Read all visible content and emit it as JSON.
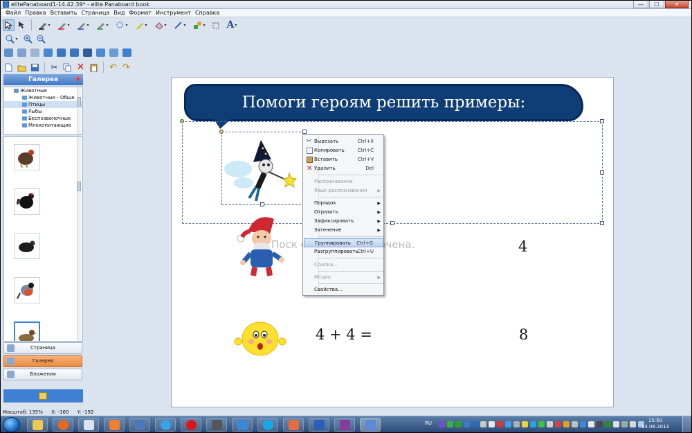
{
  "window": {
    "title": "elitePanaboard1-14.42.39* - elite Panaboard book",
    "minimize": "—",
    "maximize": "☐",
    "close": "✕"
  },
  "menu": [
    "Файл",
    "Правка",
    "Вставить",
    "Страница",
    "Вид",
    "Формат",
    "Инструмент",
    "Справка"
  ],
  "toolbar_icons": {
    "row1": [
      "select-arrow-icon",
      "pointer-tools-icon",
      "pen-icon",
      "red-pen-icon",
      "blue-pen-icon",
      "green-pen-icon",
      "brush-icon",
      "highlighter-icon",
      "eraser-icon",
      "line-icon",
      "shapes-icon",
      "resize-handle-icon",
      "text-icon"
    ],
    "row2": [
      "magnifier-icon",
      "zoom-in-icon",
      "zoom-out-icon"
    ],
    "row3": [
      "screen-capture-icon",
      "scanner-icon",
      "print-icon",
      "camera-icon",
      "monitor-icon",
      "monitor-2-icon",
      "film-icon",
      "layers-icon",
      "mouse-icon",
      "mail-icon"
    ],
    "row4": [
      "new-icon",
      "open-icon",
      "save-icon",
      "cut-icon",
      "copy-icon",
      "delete-icon",
      "paste-icon",
      "undo-icon",
      "redo-icon"
    ]
  },
  "sidebar": {
    "gallery_title": "Галерея",
    "pin_icon": "pin-icon",
    "tree": [
      "Животные",
      "Животные - Обще",
      "Птицы",
      "Рыбы",
      "Беспозвоночные",
      "Млекопитающие"
    ],
    "thumbnails": [
      "turkey",
      "black grouse",
      "wood grouse",
      "bullfinch",
      "duck"
    ],
    "nav": [
      {
        "label": "Страница",
        "active": false
      },
      {
        "label": "Галерея",
        "active": true
      },
      {
        "label": "Вложения",
        "active": false
      }
    ]
  },
  "status": {
    "zoom": "Масштаб: 135%",
    "x": "X: -160",
    "y": "Y: -192"
  },
  "slide": {
    "heading": "Помоги героям решить примеры:",
    "placeholder": "Поск                  oard не подключена.",
    "answer1": "4",
    "expr2": "4 + 4 =",
    "answer2": "8"
  },
  "context_menu": [
    {
      "label": "Вырезать",
      "shortcut": "Ctrl+X",
      "icon": "cut-icon",
      "disabled": false
    },
    {
      "label": "Копировать",
      "shortcut": "Ctrl+C",
      "icon": "copy-icon",
      "disabled": false
    },
    {
      "label": "Вставить",
      "shortcut": "Ctrl+V",
      "icon": "paste-icon",
      "disabled": false
    },
    {
      "label": "Удалить",
      "shortcut": "Del",
      "icon": "delete-icon",
      "disabled": false
    },
    {
      "label": "Распознавание",
      "shortcut": "",
      "disabled": true
    },
    {
      "label": "Язык распознавания",
      "shortcut": "",
      "submenu": true,
      "disabled": true
    },
    {
      "label": "Порядок",
      "shortcut": "",
      "submenu": true,
      "disabled": false
    },
    {
      "label": "Отразить",
      "shortcut": "",
      "submenu": true,
      "disabled": false
    },
    {
      "label": "Зафиксировать",
      "shortcut": "",
      "submenu": true,
      "disabled": false
    },
    {
      "label": "Затенение",
      "shortcut": "",
      "submenu": true,
      "disabled": false
    },
    {
      "label": "Группировать",
      "shortcut": "Ctrl+G",
      "disabled": false,
      "highlighted": true
    },
    {
      "label": "Разгруппировать",
      "shortcut": "Ctrl+U",
      "disabled": false
    },
    {
      "label": "Ссылка...",
      "shortcut": "",
      "disabled": true
    },
    {
      "label": "Медиа",
      "shortcut": "",
      "submenu": true,
      "disabled": true
    },
    {
      "label": "Свойства...",
      "shortcut": "",
      "disabled": false
    }
  ],
  "taskbar": {
    "apps": [
      "explorer",
      "media-player",
      "network",
      "internet-explorer",
      "opera",
      "microphone",
      "speaker",
      "skype",
      "paint",
      "word",
      "winrar",
      "panaboard"
    ],
    "lang": "RU",
    "time": "15:50",
    "date": "14.08.2013"
  },
  "colors": {
    "callout": "#0f3d76",
    "accent": "#3f77c6",
    "active_nav": "#ec8a3f"
  }
}
